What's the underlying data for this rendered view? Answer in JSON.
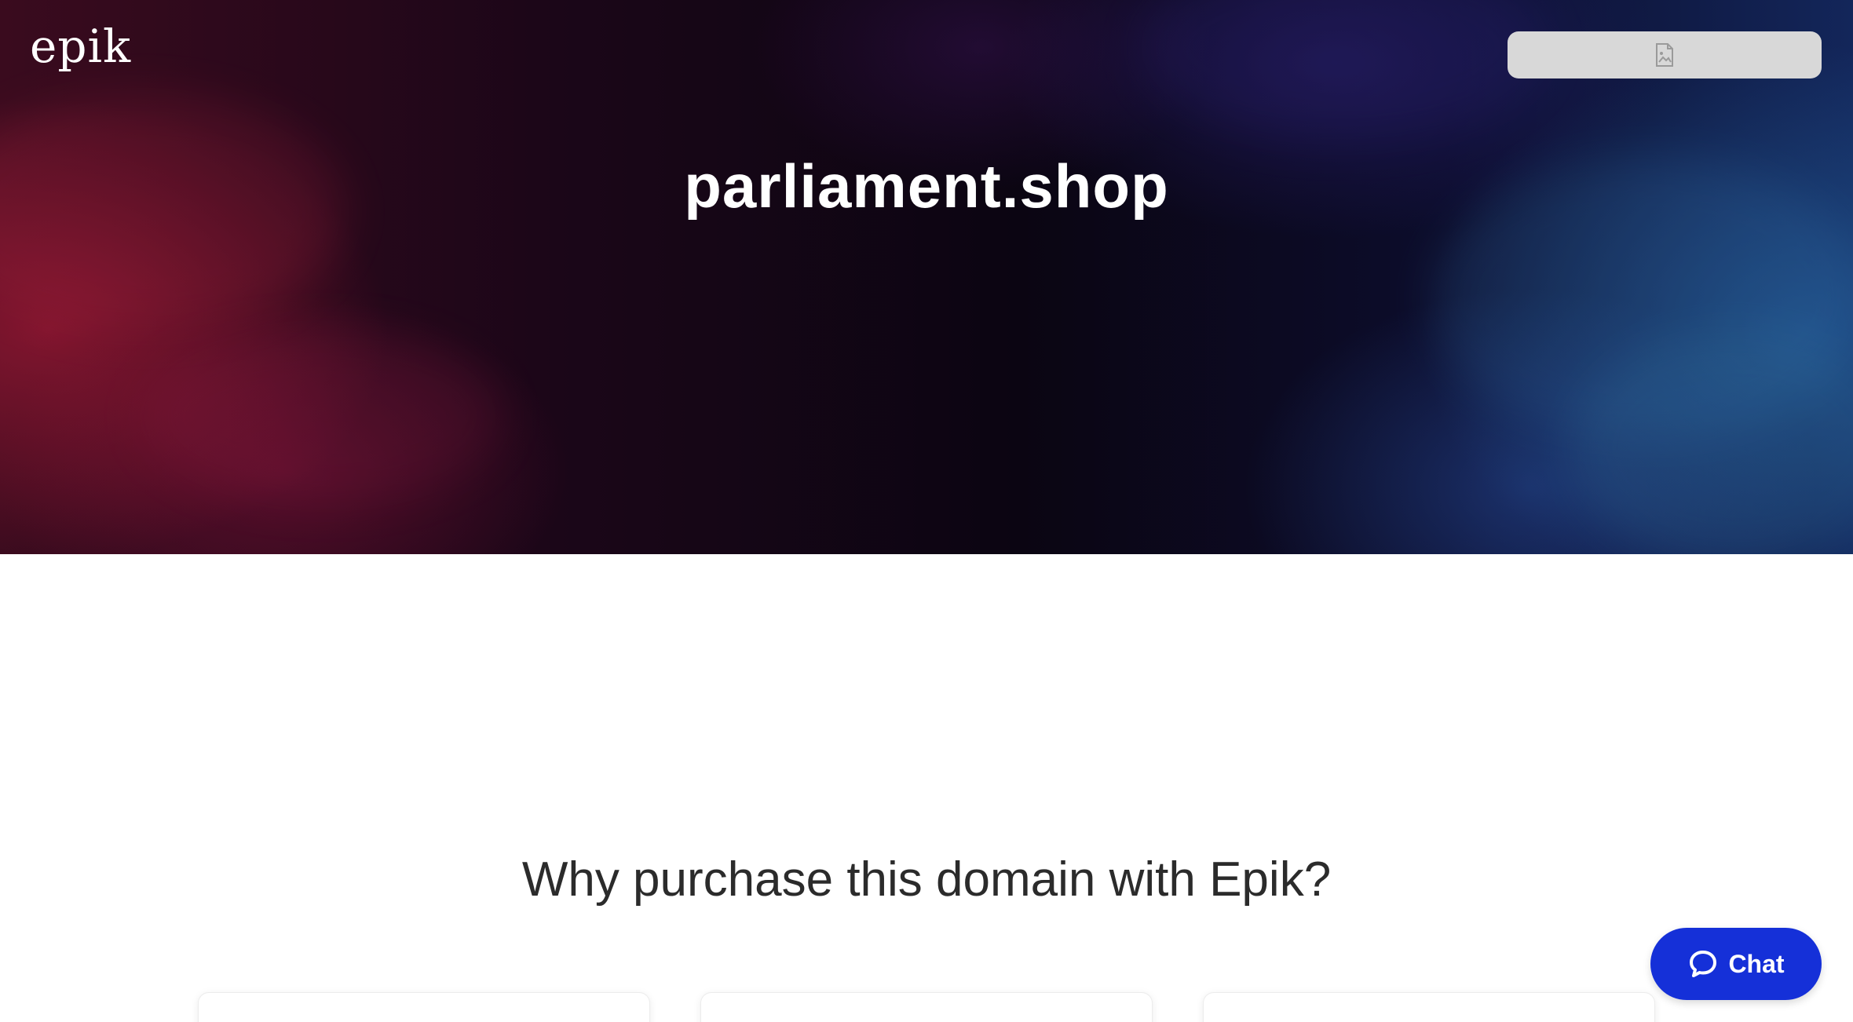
{
  "header": {
    "logo_text": "epik",
    "top_button_icon": "broken-image-icon"
  },
  "hero": {
    "domain_name": "parliament.shop"
  },
  "section": {
    "heading": "Why purchase this domain with Epik?"
  },
  "chat": {
    "label": "Chat",
    "icon": "chat-bubble-icon",
    "color": "#1530d8"
  },
  "colors": {
    "hero_left": "#3a0b1e",
    "hero_right": "#13265a",
    "heading_text": "#2b2b2b"
  }
}
